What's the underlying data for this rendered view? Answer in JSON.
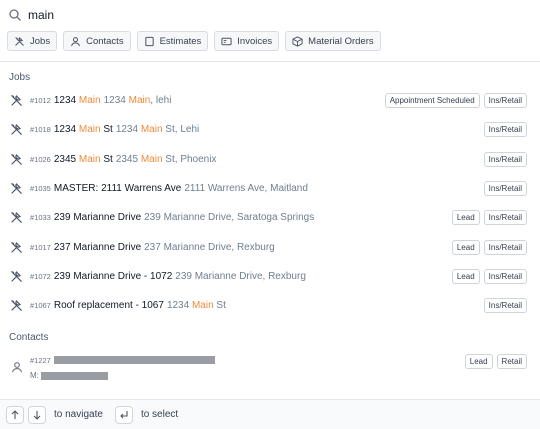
{
  "search": {
    "query": "main"
  },
  "filters": [
    {
      "label": "Jobs",
      "icon": "tools-icon"
    },
    {
      "label": "Contacts",
      "icon": "person-icon"
    },
    {
      "label": "Estimates",
      "icon": "document-icon"
    },
    {
      "label": "Invoices",
      "icon": "invoice-icon"
    },
    {
      "label": "Material Orders",
      "icon": "box-icon"
    }
  ],
  "sections": {
    "jobs": "Jobs",
    "contacts": "Contacts"
  },
  "jobs": [
    {
      "id": "#1012",
      "title": [
        {
          "t": "1234 "
        },
        {
          "t": "Main",
          "hl": true
        }
      ],
      "address": [
        {
          "t": "1234 "
        },
        {
          "t": "Main",
          "hl": true
        },
        {
          "t": ", lehi"
        }
      ],
      "badges": [
        "Appointment Scheduled",
        "Ins/Retail"
      ]
    },
    {
      "id": "#1018",
      "title": [
        {
          "t": "1234 "
        },
        {
          "t": "Main",
          "hl": true
        },
        {
          "t": " St"
        }
      ],
      "address": [
        {
          "t": "1234 "
        },
        {
          "t": "Main",
          "hl": true
        },
        {
          "t": " St, Lehi"
        }
      ],
      "badges": [
        "Ins/Retail"
      ]
    },
    {
      "id": "#1026",
      "title": [
        {
          "t": "2345 "
        },
        {
          "t": "Main",
          "hl": true
        },
        {
          "t": " St"
        }
      ],
      "address": [
        {
          "t": "2345 "
        },
        {
          "t": "Main",
          "hl": true
        },
        {
          "t": " St, Phoenix"
        }
      ],
      "badges": [
        "Ins/Retail"
      ]
    },
    {
      "id": "#1035",
      "title": [
        {
          "t": "MASTER: 2111 Warrens Ave"
        }
      ],
      "address": [
        {
          "t": "2111 Warrens Ave, Maitland"
        }
      ],
      "badges": [
        "Ins/Retail"
      ]
    },
    {
      "id": "#1033",
      "title": [
        {
          "t": "239 Marianne Drive"
        }
      ],
      "address": [
        {
          "t": "239 Marianne Drive, Saratoga Springs"
        }
      ],
      "badges": [
        "Lead",
        "Ins/Retail"
      ]
    },
    {
      "id": "#1017",
      "title": [
        {
          "t": "237 Marianne Drive"
        }
      ],
      "address": [
        {
          "t": "237 Marianne Drive, Rexburg"
        }
      ],
      "badges": [
        "Lead",
        "Ins/Retail"
      ]
    },
    {
      "id": "#1072",
      "title": [
        {
          "t": "239 Marianne Drive - 1072"
        }
      ],
      "address": [
        {
          "t": "239 Marianne Drive, Rexburg"
        }
      ],
      "badges": [
        "Lead",
        "Ins/Retail"
      ]
    },
    {
      "id": "#1067",
      "title": [
        {
          "t": "Roof replacement - 1067"
        }
      ],
      "address": [
        {
          "t": "1234 "
        },
        {
          "t": "Main",
          "hl": true
        },
        {
          "t": " St"
        }
      ],
      "badges": [
        "Ins/Retail"
      ]
    }
  ],
  "contact": {
    "id": "#1227",
    "mobile_label": "M:",
    "badges": [
      "Lead",
      "Retail"
    ]
  },
  "footer": {
    "navigate": "to navigate",
    "select": "to select"
  },
  "colors": {
    "highlight": "#f08a3c",
    "address": "#6e7f91"
  }
}
